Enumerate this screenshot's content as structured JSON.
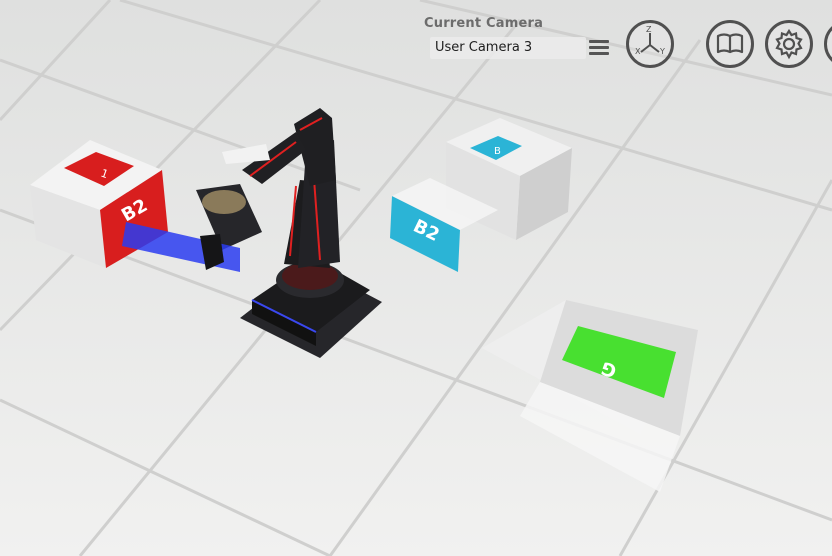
{
  "camera": {
    "heading": "Current Camera",
    "selected": "User Camera 3"
  },
  "boxes": {
    "red_label": "B2",
    "red_small_label": "1",
    "cyan_label": "B2",
    "cyan_small_label": "B",
    "green_label": "G"
  },
  "icons": [
    "menu-icon",
    "axes-icon",
    "book-icon",
    "gear-icon"
  ],
  "colors": {
    "floor": "#e9eae9",
    "robot": "#1c1c1e",
    "robot_accent": "#e02020",
    "red_box": "#d81e1e",
    "cyan_box": "#2bb4d6",
    "green_box": "#48e030",
    "blue_marker": "#2a3cf0"
  }
}
